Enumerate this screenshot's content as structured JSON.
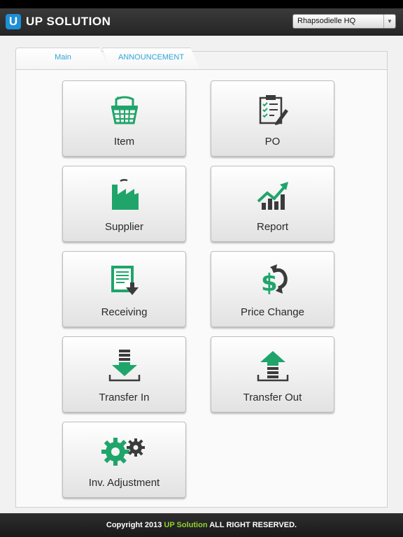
{
  "header": {
    "logo_letter": "U",
    "brand": "UP SOLUTION",
    "store_selected": "Rhapsodielle HQ"
  },
  "tabs": [
    {
      "label": "Main"
    },
    {
      "label": "ANNOUNCEMENT"
    }
  ],
  "tiles": [
    {
      "label": "Item",
      "icon": "basket-icon"
    },
    {
      "label": "PO",
      "icon": "clipboard-icon"
    },
    {
      "label": "Supplier",
      "icon": "factory-icon"
    },
    {
      "label": "Report",
      "icon": "trend-chart-icon"
    },
    {
      "label": "Receiving",
      "icon": "receiving-icon"
    },
    {
      "label": "Price Change",
      "icon": "dollar-cycle-icon"
    },
    {
      "label": "Transfer In",
      "icon": "arrow-down-tray-icon"
    },
    {
      "label": "Transfer Out",
      "icon": "arrow-up-tray-icon"
    },
    {
      "label": "Inv. Adjustment",
      "icon": "gears-icon"
    }
  ],
  "footer": {
    "prefix": "Copyright 2013 ",
    "brand": "UP Solution",
    "suffix": " ALL RIGHT RESERVED."
  },
  "colors": {
    "accent_green": "#1fa56a",
    "dark_gray": "#3b3b3b",
    "tab_text": "#2fa5d8",
    "logo_blue": "#1d8fd6",
    "footer_brand": "#8fd12f"
  }
}
